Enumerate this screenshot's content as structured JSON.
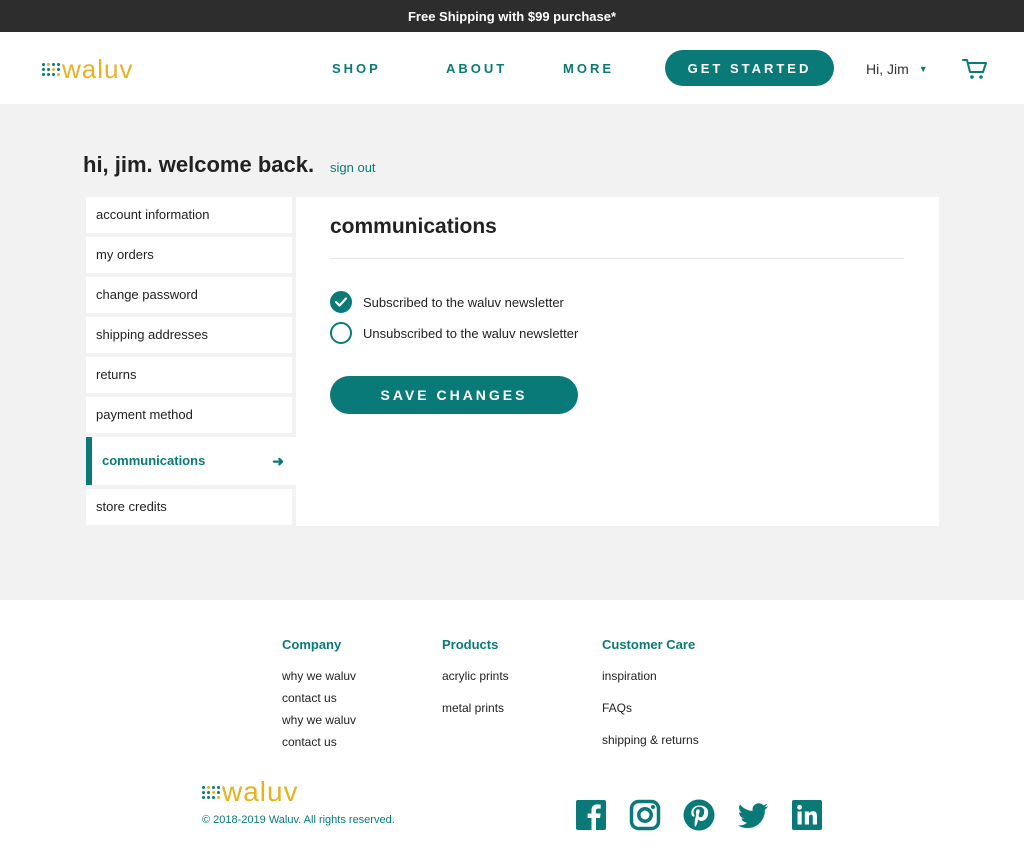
{
  "promo": {
    "text": "Free Shipping with $99 purchase*"
  },
  "brand": {
    "name": "waluv"
  },
  "nav": {
    "items": [
      {
        "label": "SHOP"
      },
      {
        "label": "ABOUT"
      },
      {
        "label": "MORE"
      }
    ],
    "cta_label": "GET STARTED",
    "user_label": "Hi, Jim"
  },
  "account": {
    "greeting": "hi, jim. welcome back.",
    "signout_label": "sign out",
    "sidebar": [
      {
        "label": "account information"
      },
      {
        "label": "my orders"
      },
      {
        "label": "change password"
      },
      {
        "label": "shipping addresses"
      },
      {
        "label": "returns"
      },
      {
        "label": "payment method"
      },
      {
        "label": "communications",
        "active": true
      },
      {
        "label": "store credits"
      }
    ]
  },
  "communications": {
    "title": "communications",
    "options": [
      {
        "label": "Subscribed to the waluv newsletter",
        "checked": true
      },
      {
        "label": "Unsubscribed to the waluv newsletter",
        "checked": false
      }
    ],
    "save_label": "SAVE CHANGES"
  },
  "footer": {
    "columns": [
      {
        "title": "Company",
        "links": [
          "why we waluv",
          "contact us",
          "why we waluv",
          "contact us"
        ]
      },
      {
        "title": "Products",
        "links": [
          "acrylic prints",
          "metal prints"
        ]
      },
      {
        "title": "Customer Care",
        "links": [
          "inspiration",
          "FAQs",
          "shipping & returns"
        ]
      }
    ],
    "copyright": "© 2018-2019 Waluv. All rights reserved.",
    "social": [
      "facebook-icon",
      "instagram-icon",
      "pinterest-icon",
      "twitter-icon",
      "linkedin-icon"
    ]
  },
  "colors": {
    "accent": "#0a7a78",
    "brand_yellow": "#e4b320",
    "promo_bg": "#2d2d2d",
    "page_bg": "#f2f2f2"
  }
}
